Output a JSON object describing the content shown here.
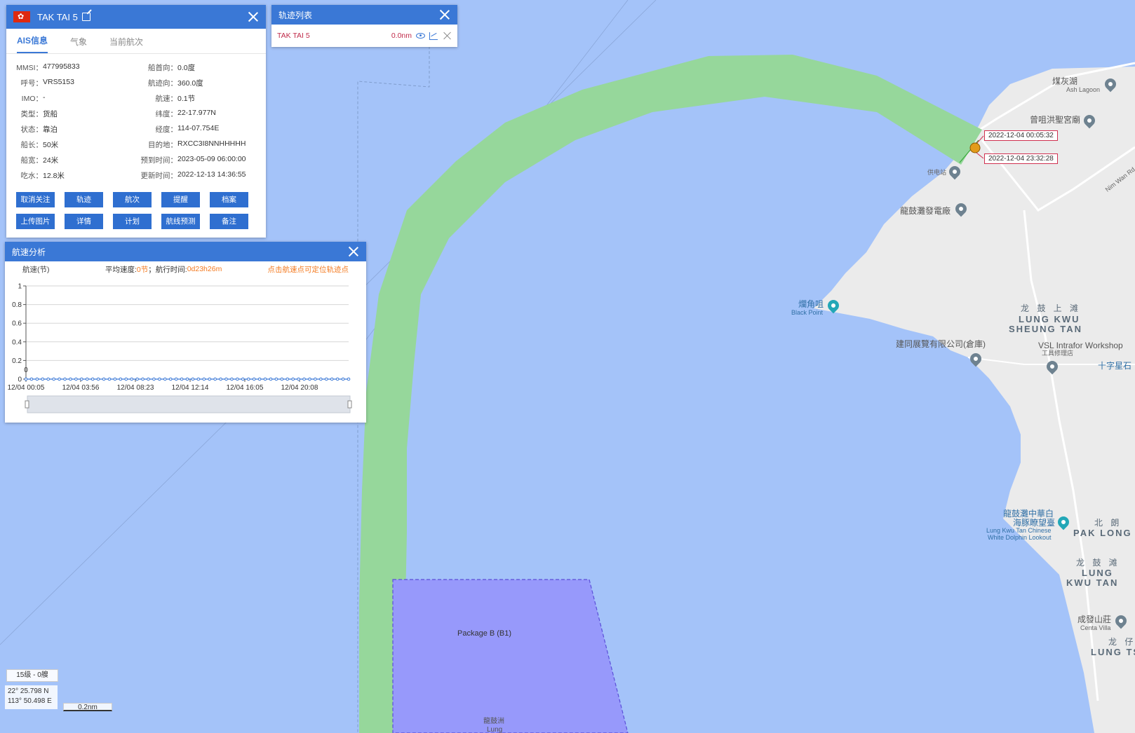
{
  "ship_panel": {
    "name": "TAK TAI 5",
    "tabs": [
      {
        "label": "AIS信息",
        "active": true
      },
      {
        "label": "气象",
        "active": false
      },
      {
        "label": "当前航次",
        "active": false
      }
    ],
    "info": [
      {
        "k1": "MMSI：",
        "v1": "477995833",
        "k2": "船首向：",
        "v2": "0.0度"
      },
      {
        "k1": "呼号：",
        "v1": "VRS5153",
        "k2": "航迹向：",
        "v2": "360.0度"
      },
      {
        "k1": "IMO：",
        "v1": "-",
        "k2": "航速：",
        "v2": "0.1节"
      },
      {
        "k1": "类型：",
        "v1": "货船",
        "k2": "纬度：",
        "v2": "22-17.977N"
      },
      {
        "k1": "状态：",
        "v1": "靠泊",
        "k2": "经度：",
        "v2": "114-07.754E"
      },
      {
        "k1": "船长：",
        "v1": "50米",
        "k2": "目的地：",
        "v2": "RXCC3I8NNHHHHH"
      },
      {
        "k1": "船宽：",
        "v1": "24米",
        "k2": "预到时间：",
        "v2": "2023-05-09 06:00:00"
      },
      {
        "k1": "吃水：",
        "v1": "12.8米",
        "k2": "更新时间：",
        "v2": "2022-12-13 14:36:55"
      }
    ],
    "buttons": [
      "取消关注",
      "轨迹",
      "航次",
      "提醒",
      "档案",
      "上传图片",
      "详情",
      "计划",
      "航线预测",
      "备注"
    ]
  },
  "track_panel": {
    "title": "轨迹列表",
    "row": {
      "name": "TAK TAI 5",
      "distance": "0.0nm"
    }
  },
  "speed_panel": {
    "title": "航速分析",
    "y_label": "航速(节)",
    "avg_label": "平均速度:",
    "avg_value": "0节",
    "sep": "；",
    "time_label": "航行时间:",
    "time_value": "0d23h26m",
    "tip": "点击航速点可定位轨迹点"
  },
  "chart_data": {
    "type": "line",
    "title": "",
    "xlabel": "",
    "ylabel": "航速(节)",
    "ylim": [
      0,
      1
    ],
    "y_ticks": [
      "0",
      "0.2",
      "0.4",
      "0.6",
      "0.8",
      "1"
    ],
    "x_ticks": [
      "12/04 00:05",
      "12/04 03:56",
      "12/04 08:23",
      "12/04 12:14",
      "12/04 16:05",
      "12/04 20:08"
    ],
    "series": [
      {
        "values": [
          0,
          0,
          0,
          0,
          0,
          0,
          0,
          0,
          0,
          0,
          0,
          0,
          0,
          0,
          0,
          0,
          0,
          0,
          0,
          0,
          0,
          0,
          0,
          0,
          0,
          0,
          0,
          0,
          0,
          0,
          0,
          0,
          0,
          0,
          0,
          0,
          0,
          0,
          0,
          0,
          0,
          0,
          0,
          0,
          0,
          0,
          0,
          0,
          0,
          0,
          0,
          0,
          0,
          0,
          0,
          0,
          0,
          0,
          0
        ]
      }
    ],
    "point_label": "0",
    "grid": true,
    "colors": {
      "line": "#3a78d6"
    }
  },
  "map": {
    "time_tags": [
      "2022-12-04 00:05:32",
      "2022-12-04 23:32:28"
    ],
    "package_label": "Package B (B1)",
    "labels": {
      "ash_lagoon_cn": "煤灰湖",
      "ash_lagoon_en": "Ash Lagoon",
      "temple": "曾咀洪聖宮廟",
      "substation": "供电站",
      "power_plant": "龍鼓灘發電廠",
      "black_point_cn": "爛角咀",
      "black_point_en": "Black Point",
      "lkst_cn": "龙 鼓 上 滩",
      "lkst_en1": "LUNG KWU",
      "lkst_en2": "SHEUNG TAN",
      "kin_tung": "建同展覽有限公司(倉庫)",
      "vsl_en": "VSL Intrafor Workshop",
      "vsl_cn": "工具修理店",
      "cross": "十字星石",
      "dolphin_cn1": "龍鼓灘中華白",
      "dolphin_cn2": "海豚瞭望臺",
      "dolphin_en1": "Lung Kwu Tan Chinese",
      "dolphin_en2": "White Dolphin Lookout",
      "pak_long_cn": "北 朗",
      "pak_long_en": "PAK LONG",
      "lkt_cn": "龙 鼓 滩",
      "lkt_en1": "LUNG",
      "lkt_en2": "KWU TAN",
      "centa_cn": "成發山莊",
      "centa_en": "Centa Villa",
      "lung_tsai_cn": "龙 仔",
      "lung_tsai_en": "LUNG TS",
      "nim_wan": "Nim Wan Rd",
      "lung_kwu_chau_cn": "龍鼓洲",
      "lung_kwu_chau_en": "Lung"
    },
    "colors": {
      "sea": "#a4c3f9",
      "channel": "#96d79b",
      "package_area": "#9799fb",
      "land": "#ebebeb"
    }
  },
  "status": {
    "zoom": "15级 - 0艘",
    "lat": "22° 25.798 N",
    "lon": "113° 50.498 E",
    "scale": "0.2nm"
  }
}
